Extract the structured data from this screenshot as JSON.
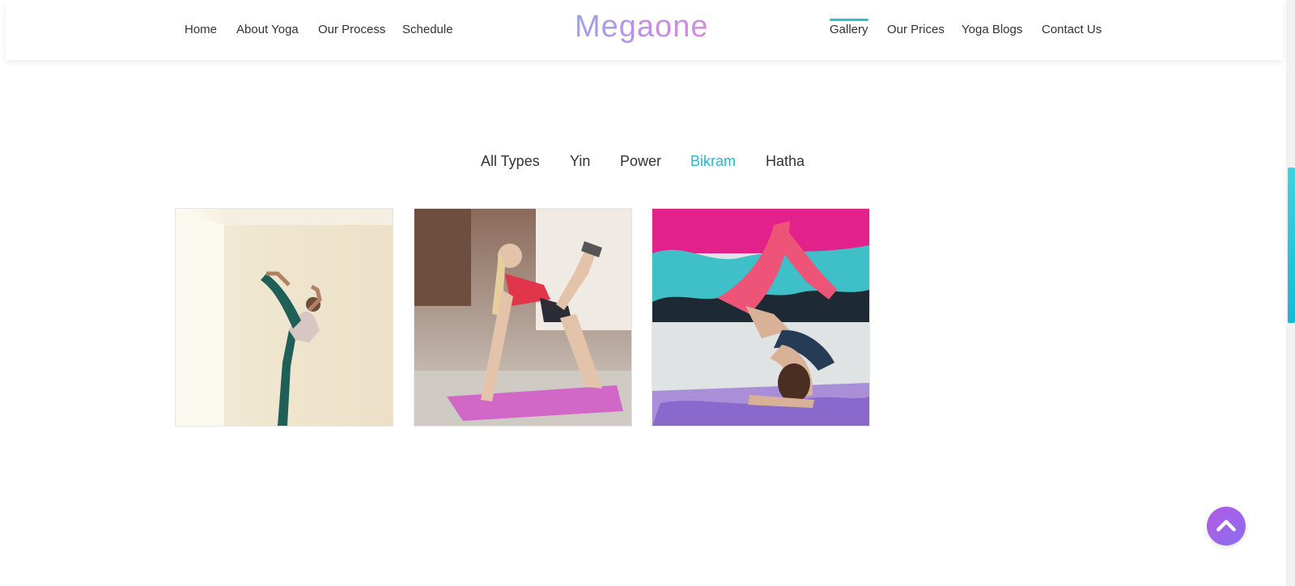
{
  "header": {
    "brand": "Megaone",
    "nav_left": [
      {
        "label": "Home"
      },
      {
        "label": "About Yoga"
      },
      {
        "label": "Our Process"
      },
      {
        "label": "Schedule"
      }
    ],
    "nav_right": [
      {
        "label": "Gallery",
        "active": true
      },
      {
        "label": "Our Prices"
      },
      {
        "label": "Yoga Blogs"
      },
      {
        "label": "Contact Us"
      }
    ]
  },
  "filters": {
    "items": [
      {
        "label": "All Types"
      },
      {
        "label": "Yin"
      },
      {
        "label": "Power"
      },
      {
        "label": "Bikram",
        "active": true
      },
      {
        "label": "Hatha"
      }
    ]
  },
  "gallery": {
    "items": [
      {
        "subject": "dancer pose in bright room"
      },
      {
        "subject": "women kneeling kickback on pink mats"
      },
      {
        "subject": "forearm stand with pink mural"
      }
    ]
  },
  "colors": {
    "accent": "#22b8d0",
    "brand_gradient_start": "#9fa0ee",
    "brand_gradient_end": "#d58bdc",
    "back_to_top_start": "#b35be3",
    "back_to_top_end": "#8a6ef0",
    "text": "#333333"
  },
  "icons": {
    "back_to_top": "chevron-up-icon"
  }
}
